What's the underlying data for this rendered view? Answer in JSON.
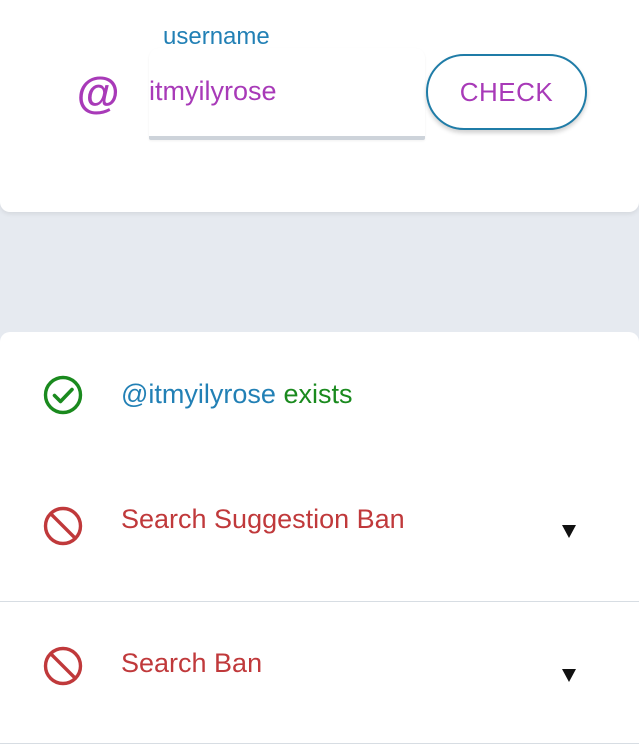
{
  "search": {
    "at_symbol": "@",
    "label": "username",
    "value": "itmyilyrose",
    "button_label": "CHECK"
  },
  "results": {
    "exists": {
      "handle": "@itmyilyrose",
      "status": "exists",
      "icon": "check-circle-icon"
    },
    "checks": [
      {
        "label": "Search Suggestion Ban",
        "icon": "ban-icon",
        "expand_icon": "caret-down-icon"
      },
      {
        "label": "Search Ban",
        "icon": "ban-icon",
        "expand_icon": "caret-down-icon"
      }
    ]
  },
  "colors": {
    "purple": "#a83ab8",
    "blue": "#2280b5",
    "green": "#1a8a1e",
    "red": "#c0393b",
    "background": "#e6eaf0",
    "card": "#ffffff"
  }
}
